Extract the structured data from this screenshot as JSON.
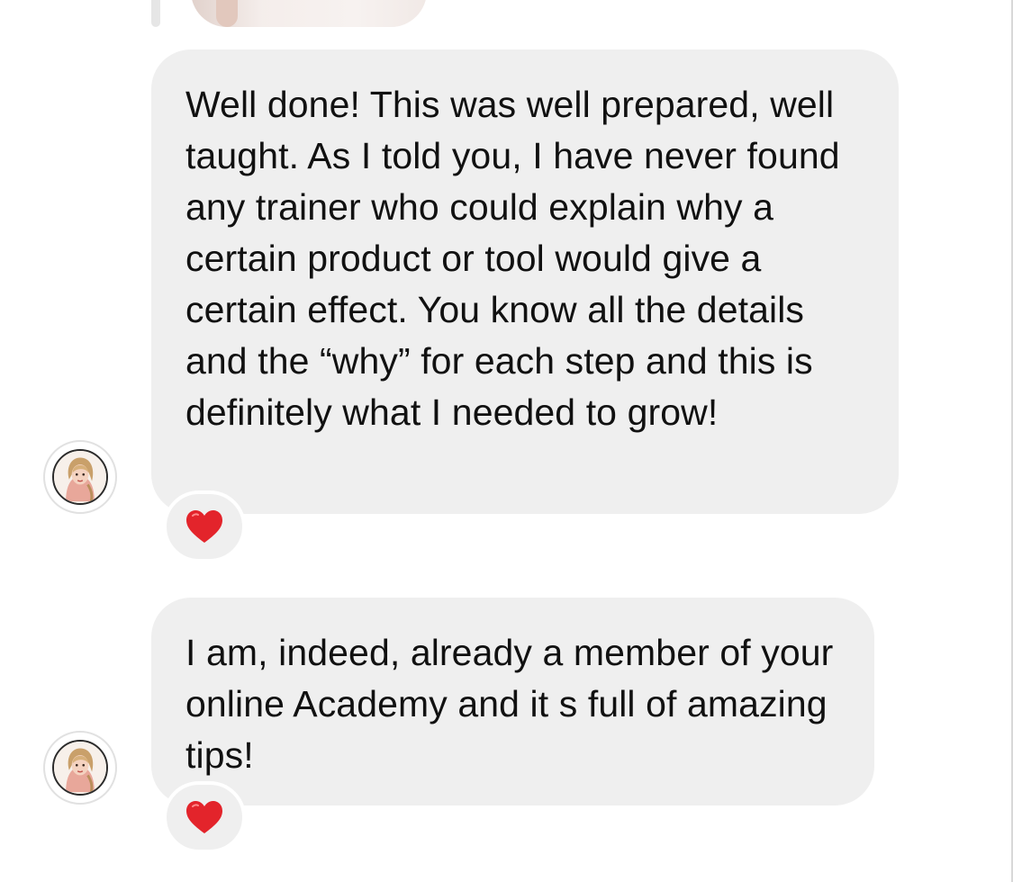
{
  "messages": [
    {
      "text": "Well done! This was well prepared, well taught. As I told you, I have never found any trainer who could explain why a certain product or tool would give a certain effect. You know all the details and the “why” for each step and this is definitely what I needed to grow!",
      "reaction": "red-heart-icon",
      "avatar": "avatar-cartoon-woman"
    },
    {
      "text": "I am, indeed, already a member of your online Academy and it s full of amazing tips!",
      "reaction": "red-heart-icon",
      "avatar": "avatar-cartoon-woman"
    }
  ],
  "colors": {
    "bubble": "#efefef",
    "text": "#111111",
    "heart": "#e3242b"
  }
}
